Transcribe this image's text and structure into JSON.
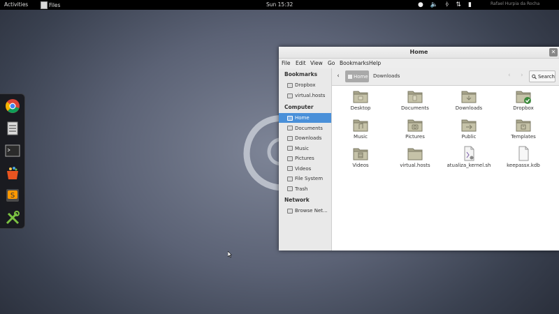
{
  "topbar": {
    "activities": "Activities",
    "app_name": "Files",
    "clock": "Sun 15:32",
    "tray_icons": [
      "accessibility-icon",
      "volume-icon",
      "bluetooth-icon",
      "network-icon",
      "battery-icon"
    ],
    "user": "Rafael Hurpia da Rocha"
  },
  "dash": {
    "items": [
      "chrome-icon",
      "files-icon",
      "terminal-icon",
      "software-center-icon",
      "sublime-text-icon",
      "scratchbox-icon"
    ]
  },
  "window": {
    "title": "Home",
    "menu": [
      "File",
      "Edit",
      "View",
      "Go",
      "Bookmarks",
      "Help"
    ],
    "sidebar": {
      "bookmarks_heading": "Bookmarks",
      "bookmarks": [
        "Dropbox",
        "virtual.hosts"
      ],
      "computer_heading": "Computer",
      "computer": [
        "Home",
        "Documents",
        "Downloads",
        "Music",
        "Pictures",
        "Videos",
        "File System",
        "Trash"
      ],
      "network_heading": "Network",
      "network": [
        "Browse Net..."
      ]
    },
    "toolbar": {
      "crumb_current": "Home",
      "crumb_next": "Downloads",
      "search_label": "Search"
    },
    "files": [
      {
        "name": "Desktop",
        "icon": "desktop-folder-icon"
      },
      {
        "name": "Documents",
        "icon": "documents-folder-icon"
      },
      {
        "name": "Downloads",
        "icon": "downloads-folder-icon"
      },
      {
        "name": "Dropbox",
        "icon": "dropbox-folder-icon"
      },
      {
        "name": "Music",
        "icon": "music-folder-icon"
      },
      {
        "name": "Pictures",
        "icon": "pictures-folder-icon"
      },
      {
        "name": "Public",
        "icon": "public-folder-icon"
      },
      {
        "name": "Templates",
        "icon": "templates-folder-icon"
      },
      {
        "name": "Videos",
        "icon": "videos-folder-icon"
      },
      {
        "name": "virtual.hosts",
        "icon": "folder-icon"
      },
      {
        "name": "atualiza_kernel.sh",
        "icon": "script-file-icon"
      },
      {
        "name": "keepassx.kdb",
        "icon": "document-file-icon"
      }
    ]
  },
  "colors": {
    "selection": "#4a90d9",
    "folder": "#b6b39a"
  }
}
